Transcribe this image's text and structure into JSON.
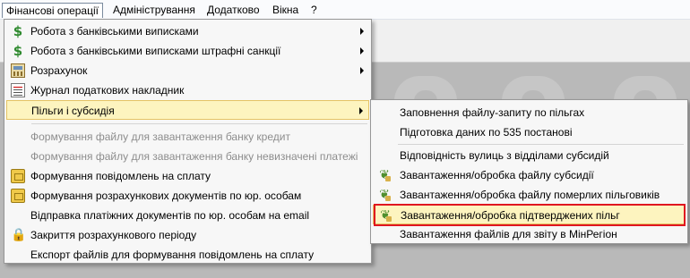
{
  "menubar": {
    "items": [
      "Фінансові операції",
      "Адміністрування",
      "Додатково",
      "Вікна",
      "?"
    ]
  },
  "main_menu": {
    "items": [
      {
        "label": "Робота з банківськими виписками",
        "icon": "dollar-icon",
        "submenu": true
      },
      {
        "label": "Робота з банківськими виписками штрафні санкції",
        "icon": "dollar-icon",
        "submenu": true
      },
      {
        "label": "Розрахунок",
        "icon": "calculator-icon",
        "submenu": true
      },
      {
        "label": "Журнал податкових накладник",
        "icon": "journal-icon"
      },
      {
        "label": "Пільги і субсидія",
        "submenu": true,
        "state": "open"
      },
      {
        "label": "Формування файлу для завантаження банку кредит",
        "disabled": true
      },
      {
        "label": "Формування файлу для завантаження банку невизначені платежі",
        "disabled": true
      },
      {
        "label": "Формування повідомлень на сплату",
        "icon": "money-icon"
      },
      {
        "label": "Формування розрахункових документів по юр. особам",
        "icon": "money-icon"
      },
      {
        "label": "Відправка платіжних документів по юр. особам на email"
      },
      {
        "label": "Закриття розрахункового періоду",
        "icon": "lock-icon"
      },
      {
        "label": "Експорт файлів для формування повідомлень на сплату"
      }
    ]
  },
  "submenu": {
    "items": [
      {
        "label": "Заповнення файлу-запиту по пільгах"
      },
      {
        "label": "Підготовка даних по 535 постанові"
      },
      {
        "label": "Відповідність вулиць з відділами субсидій"
      },
      {
        "label": "Завантаження/обробка файлу субсидії",
        "icon": "leaf-icon"
      },
      {
        "label": "Завантаження/обробка файлу померлих пільговиків",
        "icon": "leaf-icon"
      },
      {
        "label": "Завантаження/обробка підтверджених пільг",
        "icon": "leaf-icon",
        "state": "highlighted"
      },
      {
        "label": "Завантаження файлів для звіту в МінРегіон"
      }
    ]
  },
  "colors": {
    "highlight_bg": "#fdf4bf",
    "highlight_border": "#e5c365",
    "annotation_box": "#e0161f",
    "disabled_text": "#8d8d8d"
  }
}
